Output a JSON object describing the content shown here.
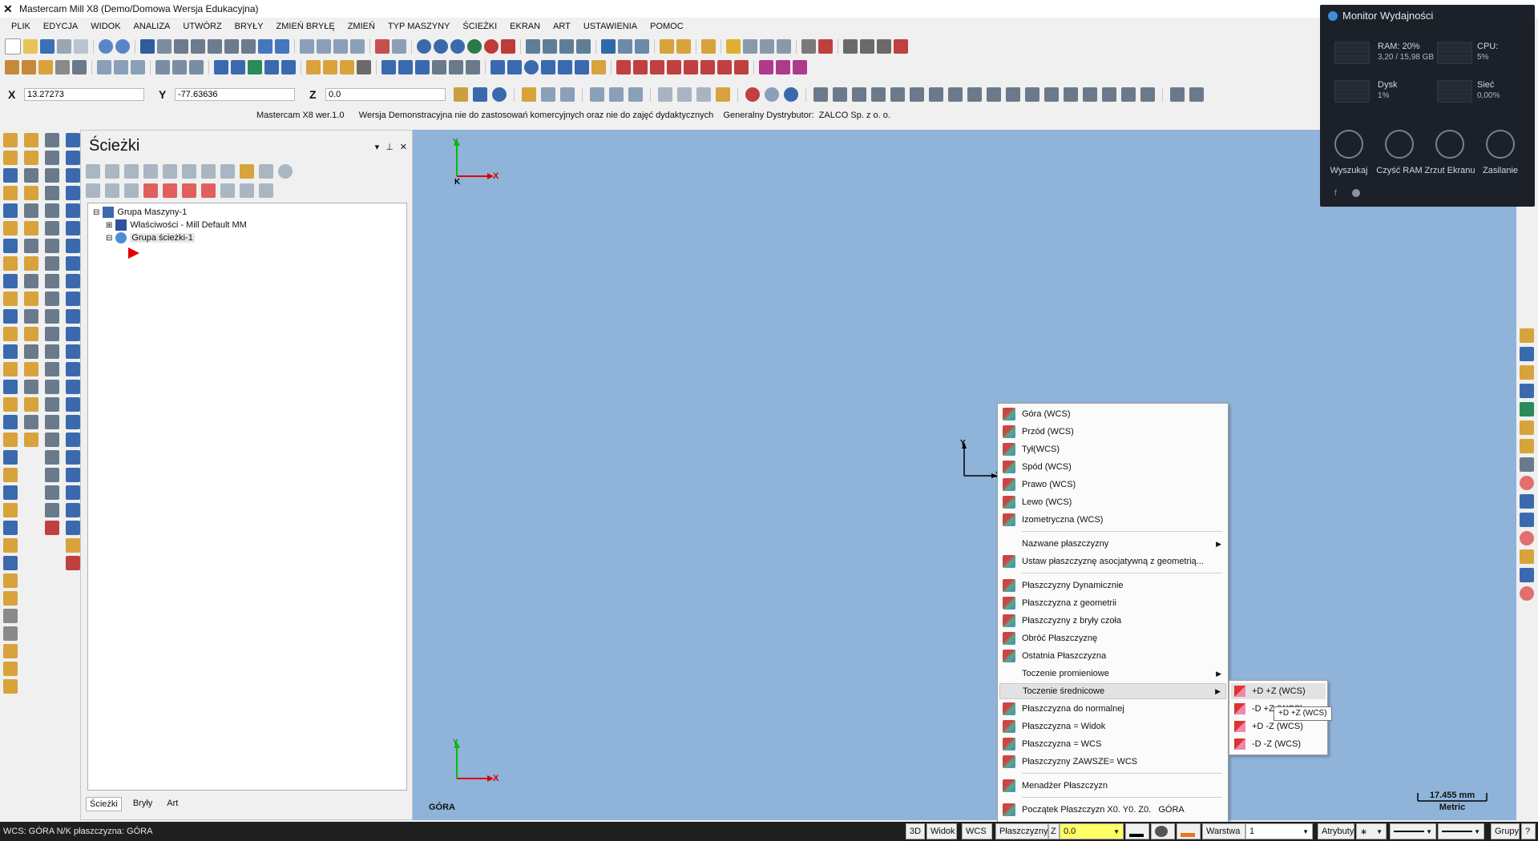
{
  "window": {
    "title": "Mastercam Mill X8 (Demo/Domowa Wersja Edukacyjna)"
  },
  "menu": [
    "PLIK",
    "EDYCJA",
    "WIDOK",
    "ANALIZA",
    "UTWÓRZ",
    "BRYŁY",
    "ZMIEŃ BRYŁĘ",
    "ZMIEŃ",
    "TYP MASZYNY",
    "ŚCIEŻKI",
    "EKRAN",
    "ART",
    "USTAWIENIA",
    "POMOC"
  ],
  "coords": {
    "x_label": "X",
    "x_value": "13.27273",
    "y_label": "Y",
    "y_value": "-77.63636",
    "z_label": "Z",
    "z_value": "0.0"
  },
  "info_line": "Mastercam X8 wer.1.0      Wersja Demonstracyjna nie do zastosowań komercyjnych oraz nie do zajęć dydaktycznych    Generalny Dystrybutor:  ZALCO Sp. z o. o.",
  "panel": {
    "title": "Ścieżki",
    "tree": {
      "root": "Grupa Maszyny-1",
      "props": "Właściwości - Mill Default MM",
      "group": "Grupa ścieżki-1"
    },
    "tabs": [
      "Ścieżki",
      "Bryły",
      "Art"
    ]
  },
  "viewport": {
    "axis_x": "X",
    "axis_y": "Y",
    "axis_k": "K",
    "view_label": "GÓRA",
    "scale_value": "17.455 mm",
    "scale_unit": "Metric",
    "bg_color": "#8fb3d9"
  },
  "context_menu": {
    "items": [
      {
        "label": "Góra (WCS)"
      },
      {
        "label": "Przód (WCS)"
      },
      {
        "label": "Tył(WCS)"
      },
      {
        "label": "Spód (WCS)"
      },
      {
        "label": "Prawo (WCS)"
      },
      {
        "label": "Lewo (WCS)"
      },
      {
        "label": "Izometryczna (WCS)"
      },
      {
        "label": "Nazwane płaszczyzny"
      },
      {
        "label": "Ustaw płaszczyznę asocjatywną z geometrią..."
      },
      {
        "label": "Płaszczyzny Dynamicznie"
      },
      {
        "label": "Płaszczyzna z geometrii"
      },
      {
        "label": "Płaszczyzny z bryły czoła"
      },
      {
        "label": "Obróć Płaszczyznę"
      },
      {
        "label": "Ostatnia Płaszczyzna"
      },
      {
        "label": "Toczenie  promieniowe"
      },
      {
        "label": "Toczenie średnicowe"
      },
      {
        "label": "Płaszczyzna do normalnej"
      },
      {
        "label": "Płaszczyzna = Widok"
      },
      {
        "label": "Płaszczyzna = WCS"
      },
      {
        "label": "Płaszczyzny ZAWSZE= WCS"
      },
      {
        "label": "Menadżer Płaszczyzn"
      },
      {
        "label": "Początek Płaszczyzn X0. Y0. Z0.   GÓRA"
      }
    ]
  },
  "submenu": {
    "items": [
      {
        "label": "+D +Z (WCS)"
      },
      {
        "label": "-D +Z (WCS)"
      },
      {
        "label": "+D -Z (WCS)"
      },
      {
        "label": "-D -Z (WCS)"
      }
    ]
  },
  "tooltip": "+D +Z (WCS)",
  "perf": {
    "title": "Monitor Wydajności",
    "ram_label": "RAM: 20%",
    "ram_detail": "3,20 / 15,98 GB",
    "cpu_label": "CPU:",
    "cpu_value": "5%",
    "disk_label": "Dysk",
    "disk_value": "1%",
    "net_label": "Sieć",
    "net_value": "0,00%",
    "buttons": [
      "Wyszukaj",
      "Czyść RAM",
      "Zrzut Ekranu",
      "Zasilanie"
    ]
  },
  "status": {
    "left": "WCS: GÓRA  N/K płaszczyzna: GÓRA",
    "btn_3d": "3D",
    "btn_widok": "Widok",
    "btn_wcs": "WCS",
    "btn_plaszczyzny": "Płaszczyzny",
    "z_label": "Z",
    "z_value": "0.0",
    "warstwa_label": "Warstwa",
    "warstwa_value": "1",
    "atrybuty": "Atrybuty",
    "grupy": "Grupy",
    "help": "?"
  }
}
